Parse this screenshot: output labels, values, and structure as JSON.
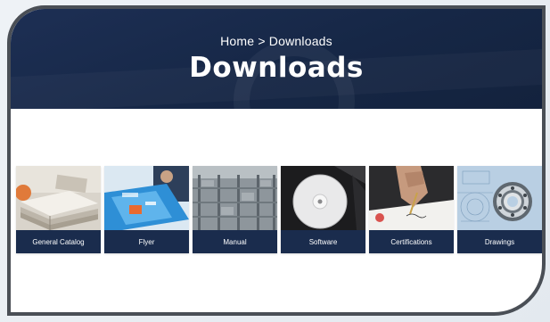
{
  "header": {
    "breadcrumb": "Home > Downloads",
    "title": "Downloads"
  },
  "tiles": [
    {
      "label": "General Catalog",
      "icon": "catalog-books-image"
    },
    {
      "label": "Flyer",
      "icon": "flyer-image"
    },
    {
      "label": "Manual",
      "icon": "manual-warehouse-image"
    },
    {
      "label": "Software",
      "icon": "software-disc-image"
    },
    {
      "label": "Certifications",
      "icon": "certificate-signing-image"
    },
    {
      "label": "Drawings",
      "icon": "bearing-drawing-image"
    }
  ],
  "colors": {
    "header_bg": "#1b2d50",
    "caption_bg": "#1a2c4d",
    "frame_border": "#4a4f56"
  }
}
